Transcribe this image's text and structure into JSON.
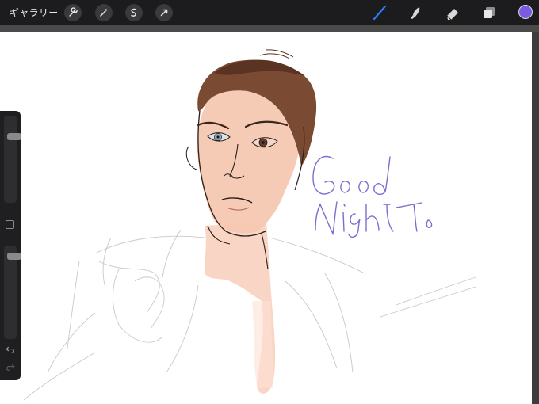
{
  "toolbar": {
    "gallery_label": "ギャラリー",
    "left_tools": [
      "wrench-icon",
      "magic-wand-icon",
      "selection-icon",
      "transform-icon"
    ],
    "right_tools": [
      "brush-icon",
      "smudge-icon",
      "eraser-icon",
      "layers-icon"
    ],
    "active_tool": "brush-icon",
    "active_color": "#7b5ce0"
  },
  "sidebar": {
    "brush_size": 0.22,
    "opacity": 0.08
  },
  "canvas": {
    "handwritten_text": [
      "Good",
      "Night."
    ]
  }
}
